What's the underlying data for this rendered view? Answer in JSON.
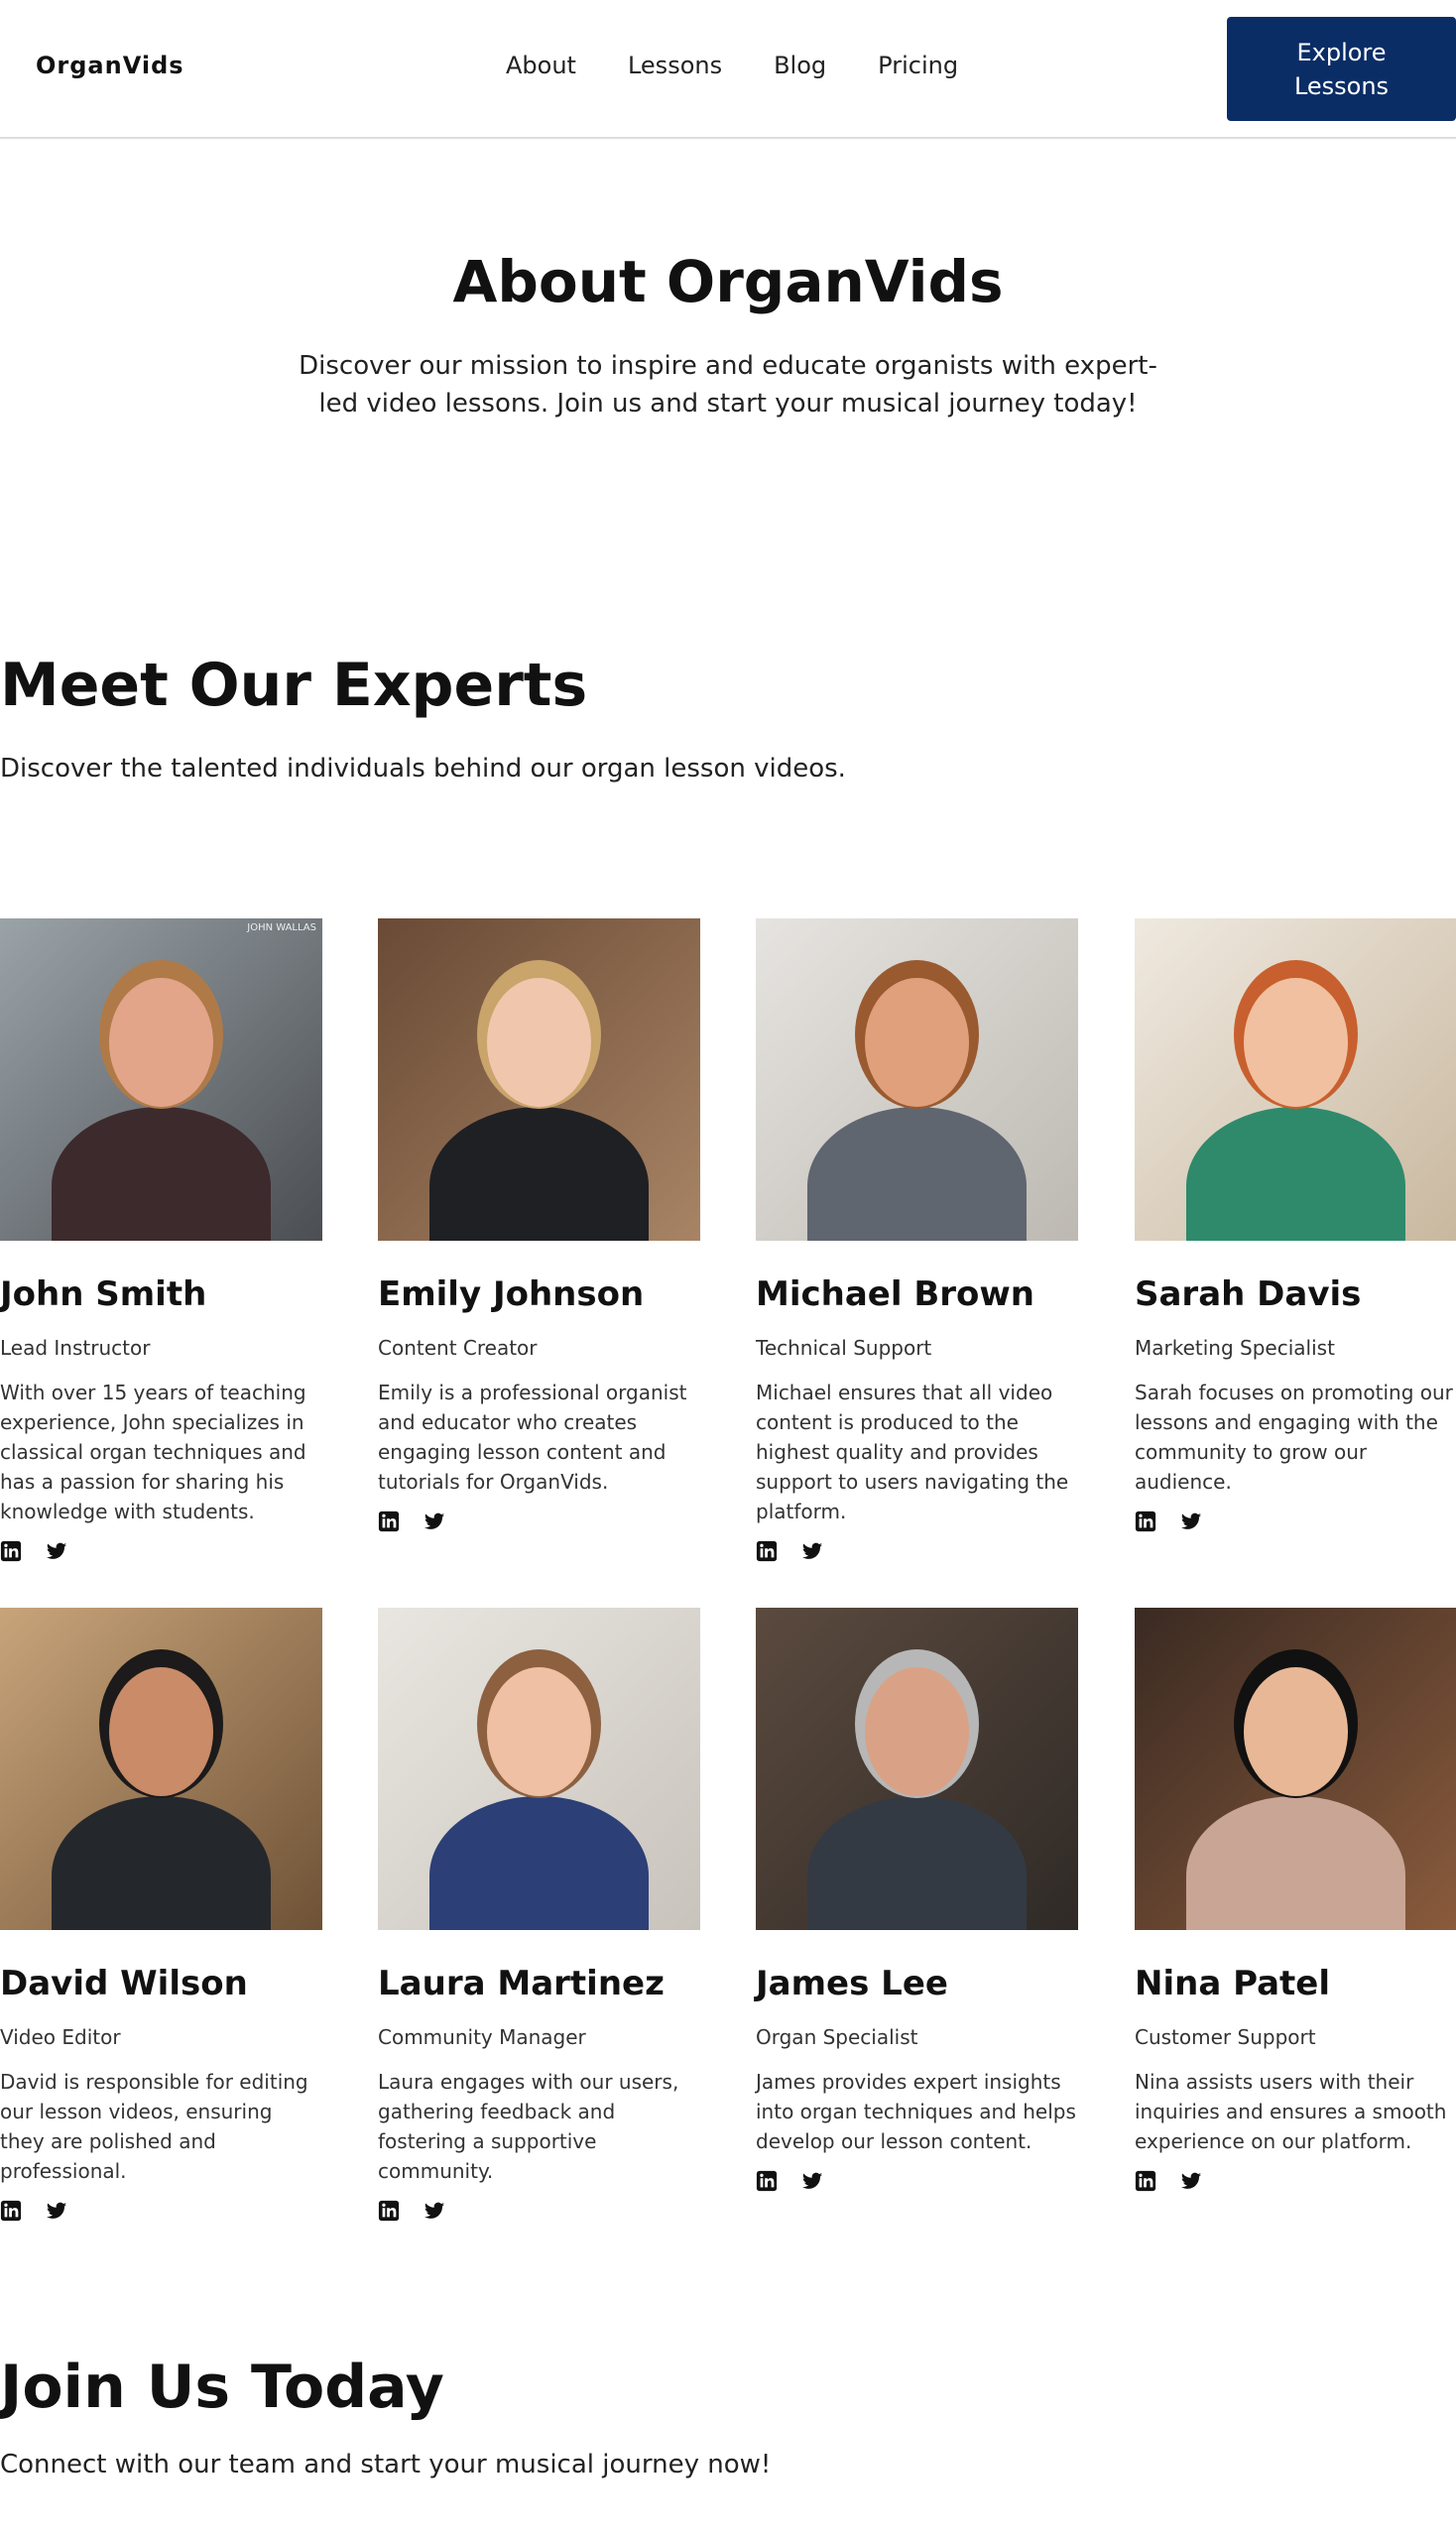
{
  "brand": "OrganVids",
  "nav": [
    "About",
    "Lessons",
    "Blog",
    "Pricing"
  ],
  "cta": "Explore Lessons",
  "hero": {
    "title": "About OrganVids",
    "subtitle": "Discover our mission to inspire and educate organists with expert-led video lessons. Join us and start your musical journey today!"
  },
  "experts": {
    "title": "Meet Our Experts",
    "subtitle": "Discover the talented individuals behind our organ lesson videos.",
    "members": [
      {
        "name": "John Smith",
        "role": "Lead Instructor",
        "bio": "With over 15 years of teaching experience, John specializes in classical organ techniques and has a passion for sharing his knowledge with students.",
        "photo_badge": "JOHN WALLAS"
      },
      {
        "name": "Emily Johnson",
        "role": "Content Creator",
        "bio": "Emily is a professional organist and educator who creates engaging lesson content and tutorials for OrganVids."
      },
      {
        "name": "Michael Brown",
        "role": "Technical Support",
        "bio": "Michael ensures that all video content is produced to the highest quality and provides support to users navigating the platform."
      },
      {
        "name": "Sarah Davis",
        "role": "Marketing Specialist",
        "bio": "Sarah focuses on promoting our lessons and engaging with the community to grow our audience."
      },
      {
        "name": "David Wilson",
        "role": "Video Editor",
        "bio": "David is responsible for editing our lesson videos, ensuring they are polished and professional."
      },
      {
        "name": "Laura Martinez",
        "role": "Community Manager",
        "bio": "Laura engages with our users, gathering feedback and fostering a supportive community."
      },
      {
        "name": "James Lee",
        "role": "Organ Specialist",
        "bio": "James provides expert insights into organ techniques and helps develop our lesson content."
      },
      {
        "name": "Nina Patel",
        "role": "Customer Support",
        "bio": "Nina assists users with their inquiries and ensures a smooth experience on our platform."
      }
    ]
  },
  "join": {
    "title": "Join Us Today",
    "subtitle": "Connect with our team and start your musical journey now!"
  },
  "social_icons": [
    "linkedin-icon",
    "twitter-icon"
  ],
  "colors": {
    "accent": "#0b2d66"
  }
}
